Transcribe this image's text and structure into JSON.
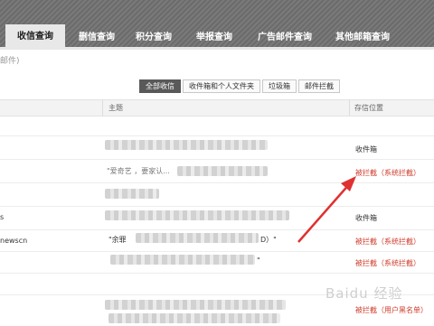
{
  "tabs": [
    {
      "label": "收信查询",
      "active": true
    },
    {
      "label": "删信查询",
      "active": false
    },
    {
      "label": "积分查询",
      "active": false
    },
    {
      "label": "举报查询",
      "active": false
    },
    {
      "label": "广告邮件查询",
      "active": false
    },
    {
      "label": "其他邮箱查询",
      "active": false
    }
  ],
  "subnote": "邮件)",
  "filters": [
    {
      "label": "全部收信",
      "active": true
    },
    {
      "label": "收件箱和个人文件夹",
      "active": false
    },
    {
      "label": "垃圾箱",
      "active": false
    },
    {
      "label": "邮件拦截",
      "active": false
    }
  ],
  "columns": {
    "subject": "主题",
    "location": "存信位置"
  },
  "rows": [
    {
      "sender": "",
      "subject": "",
      "location": "收件箱",
      "status": "normal"
    },
    {
      "sender": "",
      "subject": "\"爱奇艺 ，要家认...",
      "location": "被拦截（系统拦截）",
      "status": "blocked"
    },
    {
      "sender": "",
      "subject": "",
      "location": "",
      "status": "none"
    },
    {
      "sender": "s",
      "subject": "",
      "location": "收件箱",
      "status": "normal"
    },
    {
      "sender": "newscn",
      "subject": "\"余罪",
      "subject_end": "D）\"",
      "location": "被拦截（系统拦截）",
      "status": "blocked"
    },
    {
      "sender": "",
      "subject": "",
      "subject_end": "\"",
      "location": "被拦截（系统拦截）",
      "status": "blocked"
    },
    {
      "sender": "",
      "subject": "",
      "location": "",
      "status": "none"
    },
    {
      "sender": "",
      "subject": "",
      "location": "被拦截（用户黑名单）",
      "status": "blocked"
    }
  ],
  "colors": {
    "blocked": "#d03a2a",
    "active_filter": "#595959",
    "annotation_arrow": "#e03030"
  },
  "watermark": "Baidu 经验"
}
